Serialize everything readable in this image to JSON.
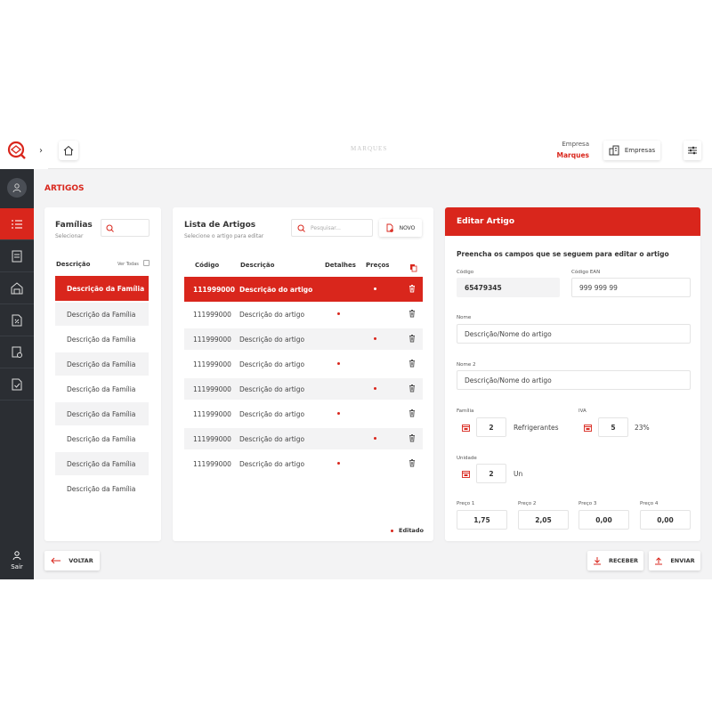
{
  "sidebar": {
    "exit_label": "Sair"
  },
  "topbar": {
    "brand": "MARQUES",
    "empresa_label": "Empresa",
    "empresa_name": "Marques",
    "empresas_button": "Empresas"
  },
  "page": {
    "title": "ARTIGOS"
  },
  "familias": {
    "title": "Famílias",
    "subtitle": "Selecionar",
    "col_descricao": "Descrição",
    "ver_todas": "Ver Todas",
    "items": [
      "Descrição da Família",
      "Descrição da Família",
      "Descrição da Família",
      "Descrição da Família",
      "Descrição da Família",
      "Descrição da Família",
      "Descrição da Família",
      "Descrição da Família",
      "Descrição da Família"
    ]
  },
  "artigos": {
    "title": "Lista de Artigos",
    "subtitle": "Selecione o artigo para editar",
    "search_placeholder": "Pesquisar...",
    "novo_button": "NOVO",
    "columns": {
      "codigo": "Código",
      "descricao": "Descrição",
      "detalhes": "Detalhes",
      "precos": "Preços"
    },
    "rows": [
      {
        "codigo": "111999000",
        "descricao": "Descrição do artigo"
      },
      {
        "codigo": "111999000",
        "descricao": "Descrição do artigo"
      },
      {
        "codigo": "111999000",
        "descricao": "Descrição do artigo"
      },
      {
        "codigo": "111999000",
        "descricao": "Descrição do artigo"
      },
      {
        "codigo": "111999000",
        "descricao": "Descrição do artigo"
      },
      {
        "codigo": "111999000",
        "descricao": "Descrição do artigo"
      },
      {
        "codigo": "111999000",
        "descricao": "Descrição do artigo"
      },
      {
        "codigo": "111999000",
        "descricao": "Descrição do artigo"
      }
    ],
    "legend": "Editado"
  },
  "editar": {
    "title": "Editar Artigo",
    "instructions": "Preencha os campos que se seguem para editar o artigo",
    "codigo_label": "Código",
    "codigo_value": "65479345",
    "ean_label": "Código EAN",
    "ean_value": "999 999 99",
    "nome_label": "Nome",
    "nome_value": "Descrição/Nome do artigo",
    "nome2_label": "Nome 2",
    "nome2_value": "Descrição/Nome do artigo",
    "familia_label": "Família",
    "familia_value": "2",
    "familia_text": "Refrigerantes",
    "iva_label": "IVA",
    "iva_value": "5",
    "iva_text": "23%",
    "unidade_label": "Unidade",
    "unidade_value": "2",
    "unidade_text": "Un",
    "preco1_label": "Preço 1",
    "preco1_value": "1,75",
    "preco2_label": "Preço 2",
    "preco2_value": "2,05",
    "preco3_label": "Preço 3",
    "preco3_value": "0,00",
    "preco4_label": "Preço 4",
    "preco4_value": "0,00"
  },
  "footer": {
    "voltar": "VOLTAR",
    "receber": "RECEBER",
    "enviar": "ENVIAR"
  },
  "colors": {
    "accent": "#d9261c",
    "sidebar": "#2b2e33"
  }
}
